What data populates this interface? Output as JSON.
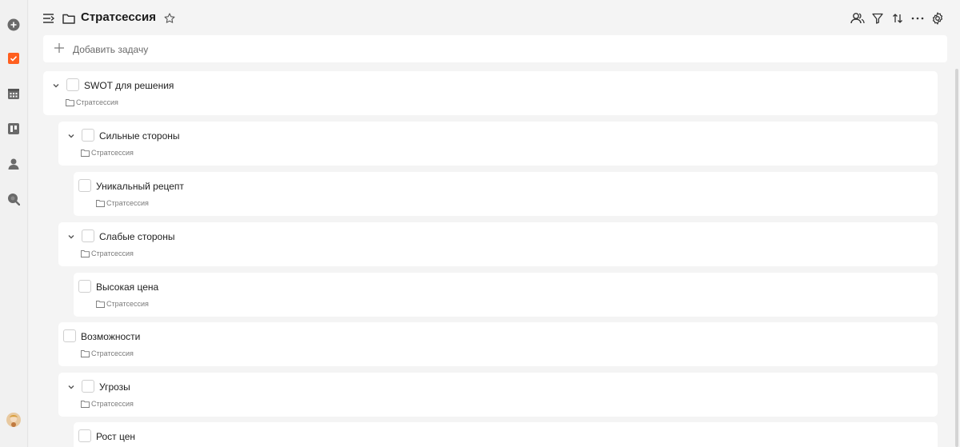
{
  "header": {
    "title": "Стратсессия"
  },
  "add_task": {
    "placeholder": "Добавить задачу"
  },
  "colors": {
    "accent": "#ff5f1f",
    "card": "#ffffff",
    "background": "#f4f4f4"
  },
  "rail": {
    "items": [
      "add-icon",
      "tasks-icon",
      "calendar-icon",
      "board-icon",
      "person-icon",
      "search-icon"
    ]
  },
  "tasks": [
    {
      "title": "SWOT для решения",
      "project": "Стратсессия",
      "level": 0,
      "expanded": true
    },
    {
      "title": "Сильные стороны",
      "project": "Стратсессия",
      "level": 1,
      "expanded": true
    },
    {
      "title": "Уникальный рецепт",
      "project": "Стратсессия",
      "level": 2
    },
    {
      "title": "Слабые стороны",
      "project": "Стратсессия",
      "level": 1,
      "expanded": true
    },
    {
      "title": "Высокая цена",
      "project": "Стратсессия",
      "level": 2
    },
    {
      "title": "Возможности",
      "project": "Стратсессия",
      "level": 1
    },
    {
      "title": "Угрозы",
      "project": "Стратсессия",
      "level": 1,
      "expanded": true
    },
    {
      "title": "Рост цен",
      "project": "",
      "level": 2
    }
  ]
}
